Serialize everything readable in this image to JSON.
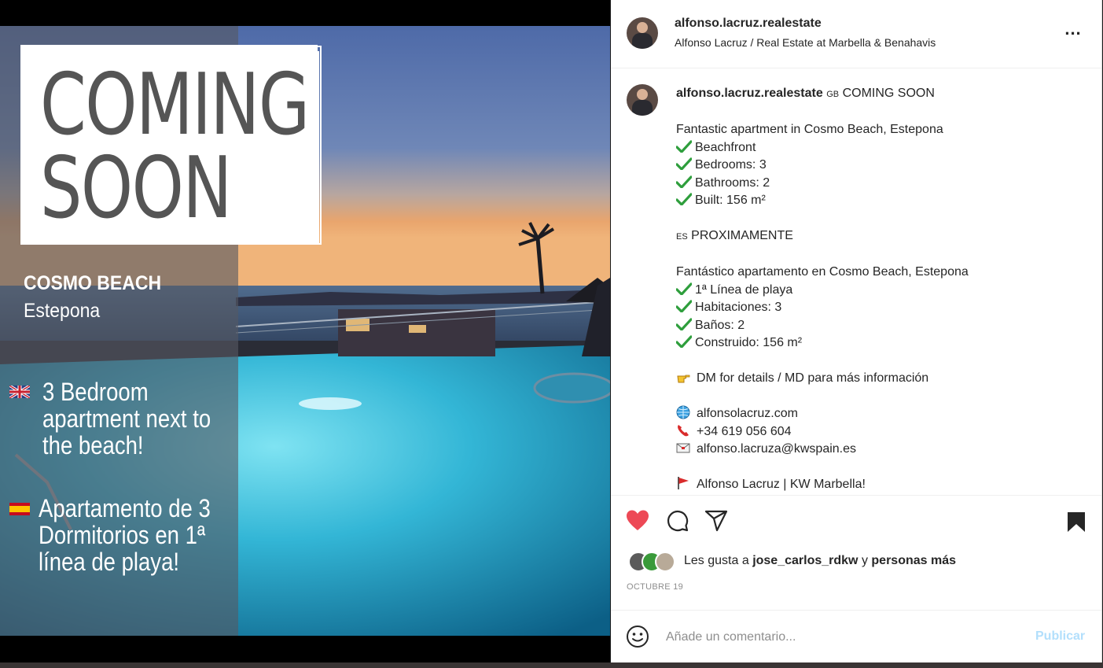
{
  "colors": {
    "link_disabled": "#b2dffc",
    "like_red": "#ed4956",
    "check_green": "#2e9e3c",
    "text": "#262626",
    "muted": "#8e8e8e"
  },
  "media": {
    "coming_line1": "COMING",
    "coming_line2": "SOON",
    "place_name": "COSMO BEACH",
    "place_city": "Estepona",
    "feature_en": "3 Bedroom apartment next to the beach!",
    "feature_es": "Apartamento de 3 Dormitorios en 1ª línea de playa!",
    "flag_en_icon": "uk-flag-icon",
    "flag_es_icon": "spain-flag-icon"
  },
  "header": {
    "username": "alfonso.lacruz.realestate",
    "subtitle": "Alfonso Lacruz / Real Estate at Marbella & Benahavis",
    "more_label": "..."
  },
  "caption": {
    "username": "alfonso.lacruz.realestate",
    "en_code": "GB",
    "en_title": "COMING SOON",
    "en_headline": "Fantastic apartment in Cosmo Beach, Estepona",
    "en_items": [
      "Beachfront",
      "Bedrooms: 3",
      "Bathrooms: 2",
      "Built: 156 m²"
    ],
    "es_code": "ES",
    "es_title": "PROXIMAMENTE",
    "es_headline": "Fantástico apartamento en Cosmo Beach, Estepona",
    "es_items": [
      "1ª Línea de playa",
      "Habitaciones: 3",
      "Baños: 2",
      "Construido: 156 m²"
    ],
    "dm_line": "DM for details / MD para más información",
    "website": "alfonsolacruz.com",
    "phone": "+34 619 056 604",
    "email": "alfonso.lacruza@kwspain.es",
    "signature": "Alfonso Lacruz | KW Marbella!"
  },
  "likes": {
    "prefix": "Les gusta a",
    "first_user": "jose_carlos_rdkw",
    "joiner": "y",
    "others": "personas más"
  },
  "post_date": "OCTUBRE 19",
  "comment": {
    "placeholder": "Añade un comentario...",
    "publish_label": "Publicar"
  }
}
